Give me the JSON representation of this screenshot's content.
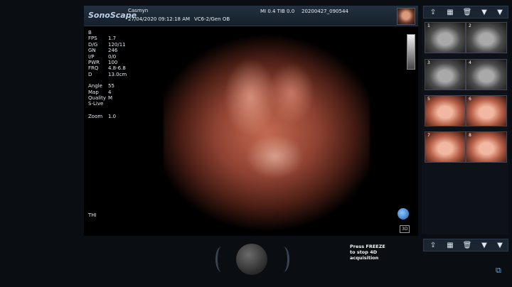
{
  "header": {
    "brand": "SonoScape",
    "patient_name": "Casmyn",
    "datetime": "27/04/2020 09:12:18 AM",
    "probe_preset": "VC6-2/Gen OB",
    "mi_tib": "MI 0.4  TIB 0.0",
    "study_id": "20200427_090544"
  },
  "params": {
    "mode": "B",
    "rows": [
      {
        "label": "FPS",
        "value": "1.7"
      },
      {
        "label": "D/G",
        "value": "120/11"
      },
      {
        "label": "GN",
        "value": "246"
      },
      {
        "label": "I/P",
        "value": "0/0"
      },
      {
        "label": "PWR",
        "value": "100"
      },
      {
        "label": "FRQ",
        "value": "4.8-6.8"
      },
      {
        "label": "D",
        "value": "13.0cm"
      }
    ],
    "rows2": [
      {
        "label": "Angle",
        "value": "55"
      },
      {
        "label": "Map",
        "value": "4"
      },
      {
        "label": "Quality",
        "value": "M"
      }
    ],
    "slive": "S-Live",
    "zoom_label": "Zoom",
    "zoom_value": "1.0",
    "thi": "THI"
  },
  "view": {
    "badge_3d": "3D"
  },
  "thumbnails": [
    {
      "n": "1"
    },
    {
      "n": "2"
    },
    {
      "n": "3"
    },
    {
      "n": "4"
    },
    {
      "n": "5"
    },
    {
      "n": "6"
    },
    {
      "n": "7"
    },
    {
      "n": "8"
    }
  ],
  "toolbar_icons": [
    "export-icon",
    "grid-icon",
    "trash-icon",
    "arrow-down-icon",
    "arrow-down-icon"
  ],
  "freeze_message": {
    "line1": "Press FREEZE",
    "line2": "to stop 4D",
    "line3": "acquisition"
  }
}
